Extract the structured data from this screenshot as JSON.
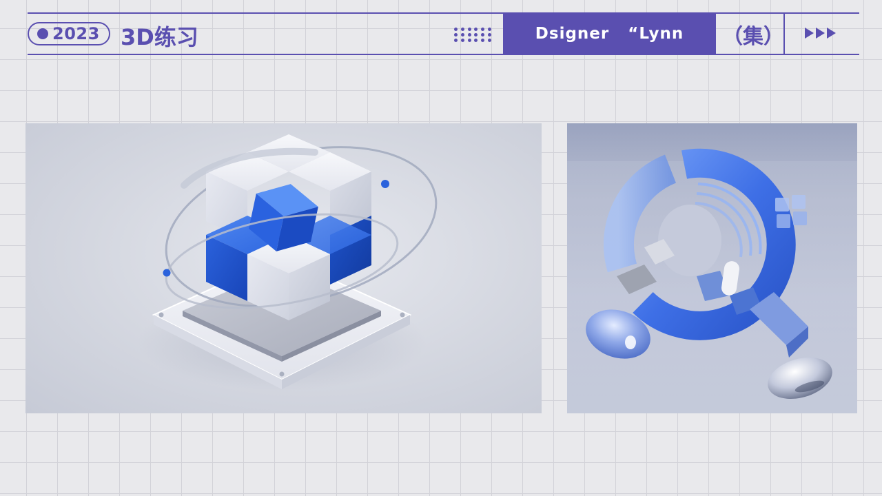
{
  "header": {
    "year": "2023",
    "title": "3D练习",
    "designer": "Dsigner   “Lynn",
    "collection": "（集）"
  },
  "icons": {
    "year_dot": "circle-bullet",
    "dot_grid": "dot-grid-decoration",
    "arrows": "triple-play-arrows"
  },
  "colors": {
    "accent": "#5a4fb0",
    "background": "#e9e9ec",
    "grid_line": "#d2d2d8",
    "render_blue": "#1f5bd6"
  },
  "renders": [
    {
      "name": "glass-cube-on-base-render"
    },
    {
      "name": "glass-ring-and-spheres-render"
    }
  ]
}
